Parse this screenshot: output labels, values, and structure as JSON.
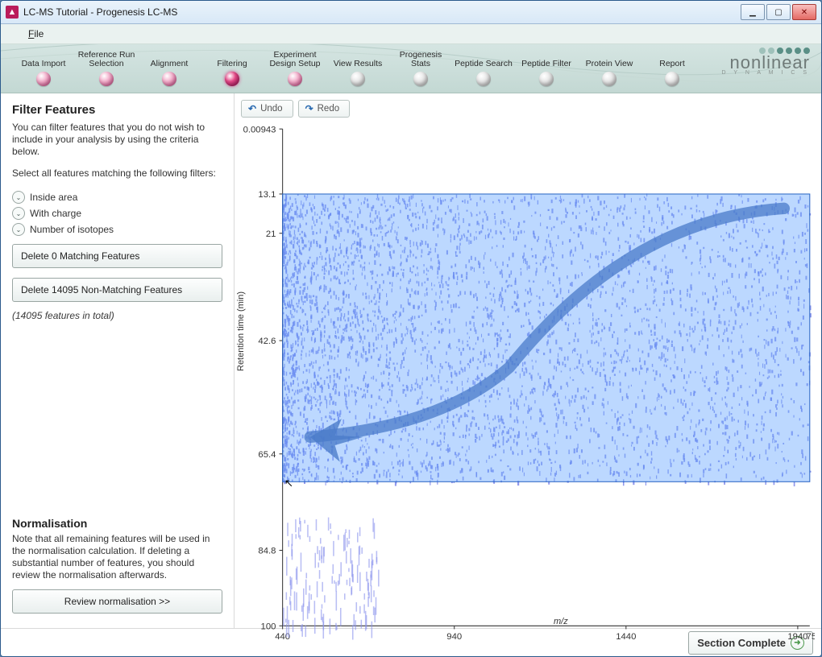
{
  "window": {
    "title": "LC-MS Tutorial - Progenesis LC-MS",
    "icon_letter": "▲"
  },
  "menu": {
    "file": "File",
    "file_mnemonic": "F"
  },
  "brand": {
    "name": "nonlinear",
    "sub": "D Y N A M I C S"
  },
  "workflow": {
    "steps": [
      {
        "label": "Data Import",
        "state": "done"
      },
      {
        "label": "Reference Run Selection",
        "state": "done"
      },
      {
        "label": "Alignment",
        "state": "done"
      },
      {
        "label": "Filtering",
        "state": "active"
      },
      {
        "label": "Experiment Design Setup",
        "state": "done"
      },
      {
        "label": "View Results",
        "state": "todo"
      },
      {
        "label": "Progenesis Stats",
        "state": "todo"
      },
      {
        "label": "Peptide Search",
        "state": "todo"
      },
      {
        "label": "Peptide Filter",
        "state": "todo"
      },
      {
        "label": "Protein View",
        "state": "todo"
      },
      {
        "label": "Report",
        "state": "todo"
      }
    ]
  },
  "sidebar": {
    "heading": "Filter Features",
    "intro": "You can filter features that you do not wish to include in your analysis by using the criteria below.",
    "select_label": "Select all features matching the following filters:",
    "expanders": [
      {
        "label": "Inside area"
      },
      {
        "label": "With charge"
      },
      {
        "label": "Number of isotopes"
      }
    ],
    "delete_matching": "Delete 0 Matching Features",
    "delete_nonmatching": "Delete 14095 Non-Matching Features",
    "total": "(14095 features in total)",
    "norm_heading": "Normalisation",
    "norm_text": "Note that all remaining features will be used in the normalisation calculation. If deleting a substantial number of features, you should review the normalisation afterwards.",
    "review_btn": "Review normalisation >>"
  },
  "toolbar": {
    "undo": "Undo",
    "redo": "Redo"
  },
  "footer": {
    "section_complete": "Section Complete"
  },
  "chart_data": {
    "type": "scatter",
    "xlabel": "m/z",
    "ylabel": "Retention time (min)",
    "x_ticks": [
      440,
      940,
      1440,
      1940
    ],
    "x_tick_extra": "75",
    "y_ticks": [
      0.00943,
      13.1,
      21,
      42.6,
      65.4,
      84.8,
      100
    ],
    "xlim": [
      440,
      1975
    ],
    "ylim": [
      0.00943,
      100
    ],
    "selection_box": {
      "x0": 440,
      "x1": 1975,
      "rt0": 13.1,
      "rt1": 71
    },
    "note": "Dense scatter of ~14095 LC-MS features concentrated at low m/z and RT 13–65 min, thinning toward higher m/z; sparse vertical streaks near RT 80–100. Blue rectangle marks the currently selected filter area with a large demo annotation arrow pointing into the lower-left corner."
  }
}
